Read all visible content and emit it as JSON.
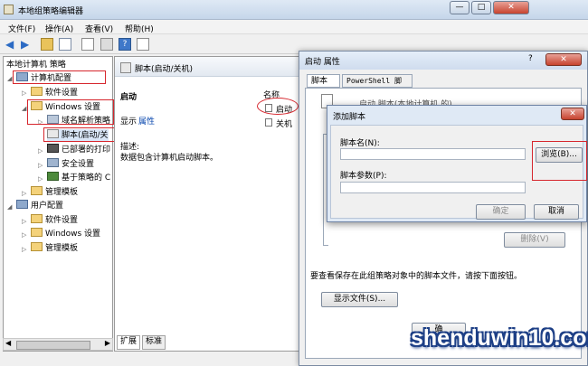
{
  "window": {
    "title": "本地组策略编辑器",
    "min": "—",
    "max": "□",
    "close": "✕"
  },
  "menu": [
    "文件(F)",
    "操作(A)",
    "查看(V)",
    "帮助(H)"
  ],
  "tree": {
    "root": "本地计算机 策略",
    "computer_config": "计算机配置",
    "software_settings": "软件设置",
    "windows_settings": "Windows 设置",
    "dns_policy": "域名解析策略",
    "scripts": "脚本(启动/关",
    "printers": "已部署的打印",
    "security": "安全设置",
    "qos": "基于策略的 C",
    "admin_templates": "管理模板",
    "user_config": "用户配置",
    "u_software": "软件设置",
    "u_windows": "Windows 设置",
    "u_admin": "管理模板"
  },
  "right": {
    "header": "脚本(启动/关机)",
    "section": "启动",
    "display_label": "显示",
    "properties_link": "属性",
    "desc_label": "描述:",
    "desc_text": "数据包含计算机启动脚本。",
    "col_name": "名称",
    "items": [
      "启动",
      "关机"
    ],
    "tabs": [
      "扩展",
      "标准"
    ]
  },
  "props": {
    "title": "启动 属性",
    "tabs": [
      "脚本",
      "PowerShell 脚本"
    ],
    "desc_partial": "启动 脚本(本地计算机 的)",
    "hint": "要查看保存在此组策略对象中的脚本文件，请按下面按钮。",
    "show_files": "显示文件(S)...",
    "delete": "删除(V)",
    "ok_partial": "确"
  },
  "add_script": {
    "title": "添加脚本",
    "name_label": "脚本名(N):",
    "params_label": "脚本参数(P):",
    "browse": "浏览(B)...",
    "ok": "确定",
    "cancel": "取消",
    "name_value": "",
    "params_value": ""
  },
  "watermark": "shenduwin10.com",
  "accent_red": "#d6262d"
}
